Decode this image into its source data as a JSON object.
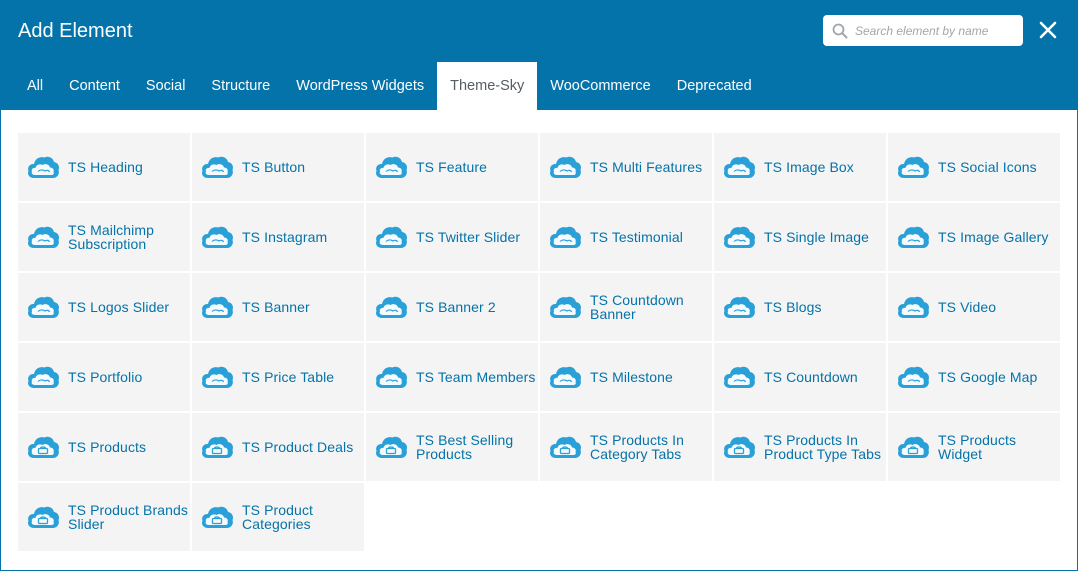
{
  "dialog": {
    "title": "Add Element",
    "search_placeholder": "Search element by name",
    "search_value": ""
  },
  "tabs": [
    {
      "label": "All",
      "active": false
    },
    {
      "label": "Content",
      "active": false
    },
    {
      "label": "Social",
      "active": false
    },
    {
      "label": "Structure",
      "active": false
    },
    {
      "label": "WordPress Widgets",
      "active": false
    },
    {
      "label": "Theme-Sky",
      "active": true
    },
    {
      "label": "WooCommerce",
      "active": false
    },
    {
      "label": "Deprecated",
      "active": false
    }
  ],
  "elements": [
    {
      "label": "TS Heading",
      "icon": "cloud-icon"
    },
    {
      "label": "TS Button",
      "icon": "cloud-icon"
    },
    {
      "label": "TS Feature",
      "icon": "cloud-icon"
    },
    {
      "label": "TS Multi Features",
      "icon": "cloud-icon"
    },
    {
      "label": "TS Image Box",
      "icon": "cloud-icon"
    },
    {
      "label": "TS Social Icons",
      "icon": "cloud-icon"
    },
    {
      "label": "TS Mailchimp Subscription",
      "icon": "cloud-icon"
    },
    {
      "label": "TS Instagram",
      "icon": "cloud-icon"
    },
    {
      "label": "TS Twitter Slider",
      "icon": "cloud-icon"
    },
    {
      "label": "TS Testimonial",
      "icon": "cloud-icon"
    },
    {
      "label": "TS Single Image",
      "icon": "cloud-icon"
    },
    {
      "label": "TS Image Gallery",
      "icon": "cloud-icon"
    },
    {
      "label": "TS Logos Slider",
      "icon": "cloud-icon"
    },
    {
      "label": "TS Banner",
      "icon": "cloud-icon"
    },
    {
      "label": "TS Banner 2",
      "icon": "cloud-icon"
    },
    {
      "label": "TS Countdown Banner",
      "icon": "cloud-icon"
    },
    {
      "label": "TS Blogs",
      "icon": "cloud-icon"
    },
    {
      "label": "TS Video",
      "icon": "cloud-icon"
    },
    {
      "label": "TS Portfolio",
      "icon": "cloud-icon"
    },
    {
      "label": "TS Price Table",
      "icon": "cloud-icon"
    },
    {
      "label": "TS Team Members",
      "icon": "cloud-icon"
    },
    {
      "label": "TS Milestone",
      "icon": "cloud-icon"
    },
    {
      "label": "TS Countdown",
      "icon": "cloud-icon"
    },
    {
      "label": "TS Google Map",
      "icon": "cloud-icon"
    },
    {
      "label": "TS Products",
      "icon": "cloud-basket-icon"
    },
    {
      "label": "TS Product Deals",
      "icon": "cloud-basket-icon"
    },
    {
      "label": "TS Best Selling Products",
      "icon": "cloud-basket-icon"
    },
    {
      "label": "TS Products In Category Tabs",
      "icon": "cloud-basket-icon"
    },
    {
      "label": "TS Products In Product Type Tabs",
      "icon": "cloud-basket-icon"
    },
    {
      "label": "TS Products Widget",
      "icon": "cloud-basket-icon"
    },
    {
      "label": "TS Product Brands Slider",
      "icon": "cloud-basket-icon"
    },
    {
      "label": "TS Product Categories",
      "icon": "cloud-basket-icon"
    }
  ],
  "colors": {
    "header": "#0473aa",
    "accent_text": "#0473aa",
    "icon_fill": "#2aa0d8",
    "tile_bg": "#f4f4f4",
    "active_tab_text": "#555d66"
  }
}
